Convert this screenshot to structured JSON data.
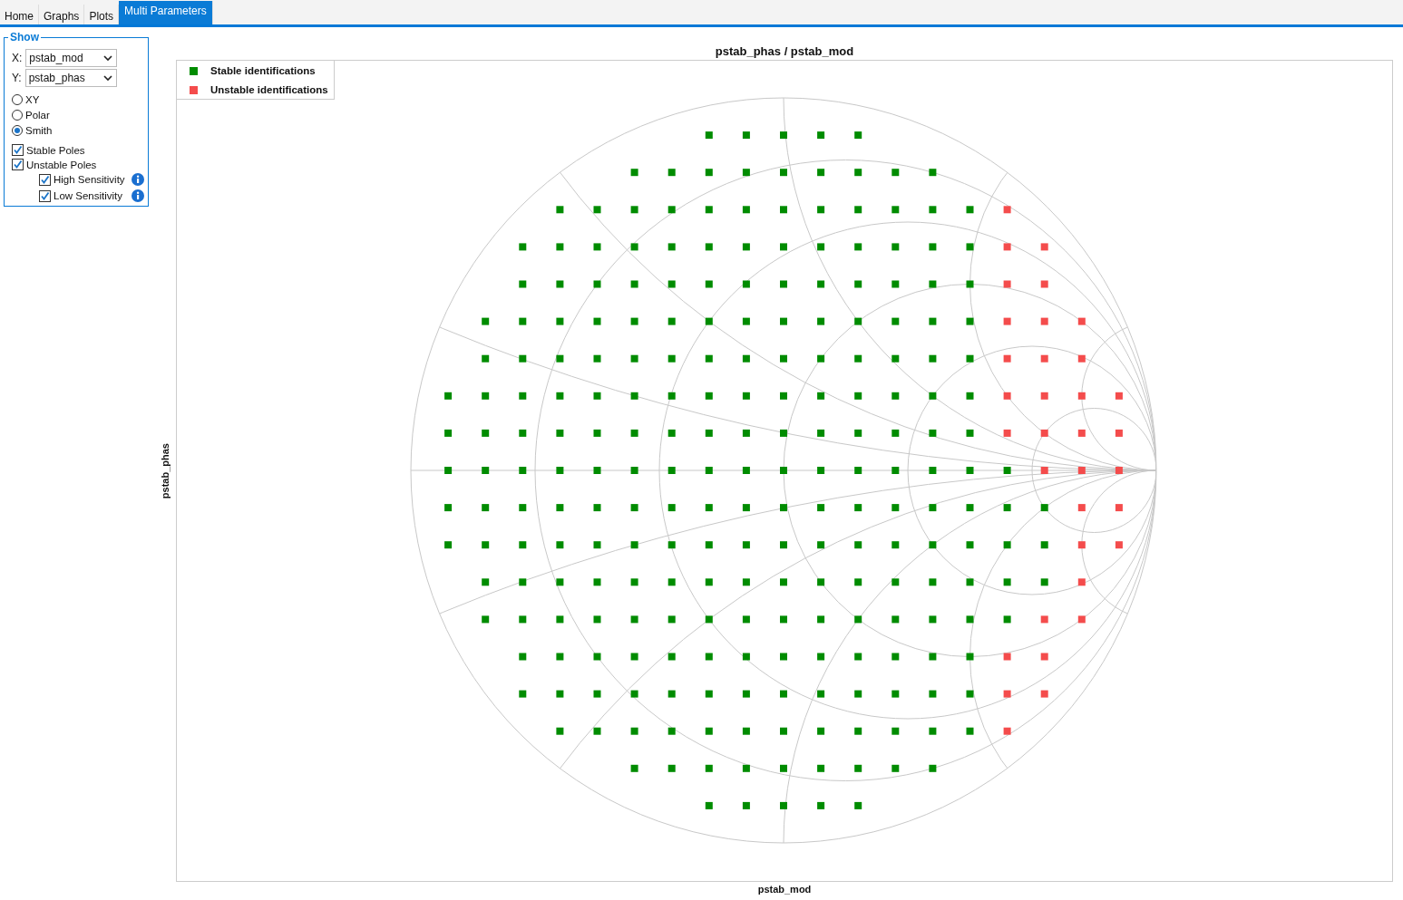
{
  "tabs": [
    {
      "label": "Home",
      "selected": false
    },
    {
      "label": "Graphs",
      "selected": false
    },
    {
      "label": "Plots",
      "selected": false
    },
    {
      "label": "Multi Parameters",
      "selected": true
    }
  ],
  "show_panel": {
    "title": "Show",
    "axes": [
      {
        "label": "X:",
        "value": "pstab_mod"
      },
      {
        "label": "Y:",
        "value": "pstab_phas"
      }
    ],
    "plot_types": [
      {
        "label": "XY",
        "selected": false
      },
      {
        "label": "Polar",
        "selected": false
      },
      {
        "label": "Smith",
        "selected": true
      }
    ],
    "filters": [
      {
        "label": "Stable Poles",
        "checked": true
      },
      {
        "label": "Unstable Poles",
        "checked": true,
        "children": [
          {
            "label": "High Sensitivity",
            "checked": true,
            "info_icon": true
          },
          {
            "label": "Low Sensitivity",
            "checked": true,
            "info_icon": true
          }
        ]
      }
    ]
  },
  "plot": {
    "title": "pstab_phas / pstab_mod",
    "xlabel": "pstab_mod",
    "ylabel": "pstab_phas",
    "legend": [
      {
        "label": "Stable identifications",
        "color": "#008c00"
      },
      {
        "label": "Unstable identifications",
        "color": "#f44c4c"
      }
    ]
  }
}
